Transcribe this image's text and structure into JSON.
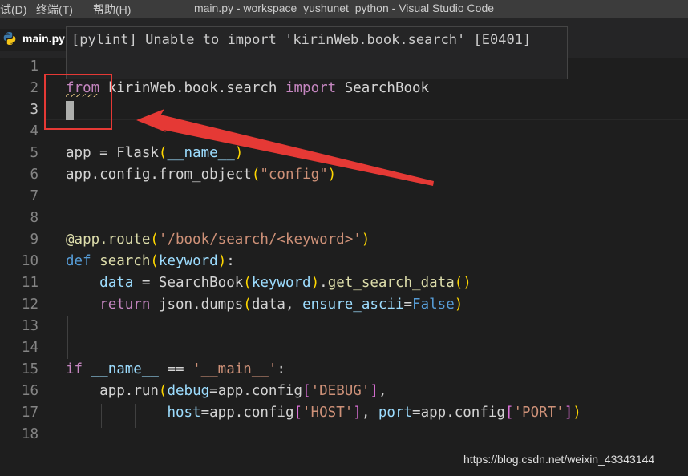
{
  "titlebar": {
    "menu_partial": "试(D)",
    "menu_terminal": "终端(T)",
    "menu_help": "帮助(H)",
    "window_title": "main.py - workspace_yushunet_python - Visual Studio Code"
  },
  "tab": {
    "label": "main.py",
    "icon": "python-icon"
  },
  "tooltip": {
    "text": "[pylint] Unable to import 'kirinWeb.book.search' [E0401]"
  },
  "editor": {
    "active_line": 3,
    "line_numbers": [
      "1",
      "2",
      "3",
      "4",
      "5",
      "6",
      "7",
      "8",
      "9",
      "10",
      "11",
      "12",
      "13",
      "14",
      "15",
      "16",
      "17",
      "18"
    ],
    "lines": {
      "l2": {
        "from": "from",
        "mod": "kirinWeb.book.search",
        "imp": "import",
        "cls": "SearchBook"
      },
      "l5": {
        "app": "app",
        "eq": " = ",
        "flask": "Flask",
        "lp": "(",
        "name": "__name__",
        "rp": ")"
      },
      "l6": {
        "pre": "app.config.",
        "fn": "from_object",
        "lp": "(",
        "s": "\"config\"",
        "rp": ")"
      },
      "l9": {
        "dec": "@app.route",
        "lp": "(",
        "s": "'/book/search/<keyword>'",
        "rp": ")"
      },
      "l10": {
        "def": "def",
        "sp": " ",
        "fn": "search",
        "lp": "(",
        "arg": "keyword",
        "rp": ")",
        "colon": ":"
      },
      "l11": {
        "ind": "    ",
        "data": "data",
        "eq": " = ",
        "cls": "SearchBook",
        "lp": "(",
        "arg": "keyword",
        "rp": ")",
        "dot": ".",
        "fn": "get_search_data",
        "lp2": "(",
        "rp2": ")"
      },
      "l12": {
        "ind": "    ",
        "ret": "return",
        "pre": " json.",
        "fn": "dumps",
        "lp": "(",
        "arg": "data",
        "comma": ", ",
        "kw": "ensure_ascii",
        "eq": "=",
        "false": "False",
        "rp": ")"
      },
      "l15": {
        "if": "if",
        "sp": " ",
        "name": "__name__",
        "eq": " == ",
        "s": "'__main__'",
        "colon": ":"
      },
      "l16": {
        "ind": "    ",
        "pre": "app.",
        "fn": "run",
        "lp": "(",
        "kw": "debug",
        "eq": "=",
        "cfg": "app.config",
        "lb": "[",
        "s": "'DEBUG'",
        "rb": "]",
        "comma": ","
      },
      "l17": {
        "ind": "            ",
        "kw": "host",
        "eq": "=",
        "cfg": "app.config",
        "lb": "[",
        "s": "'HOST'",
        "rb": "]",
        "comma": ", ",
        "kw2": "port",
        "eq2": "=",
        "cfg2": "app.config",
        "lb2": "[",
        "s2": "'PORT'",
        "rb2": "]",
        "rp": ")"
      }
    }
  },
  "annotation": {
    "box_color": "#e53935",
    "arrow_color": "#e53935"
  },
  "watermark": "https://blog.csdn.net/weixin_43343144"
}
